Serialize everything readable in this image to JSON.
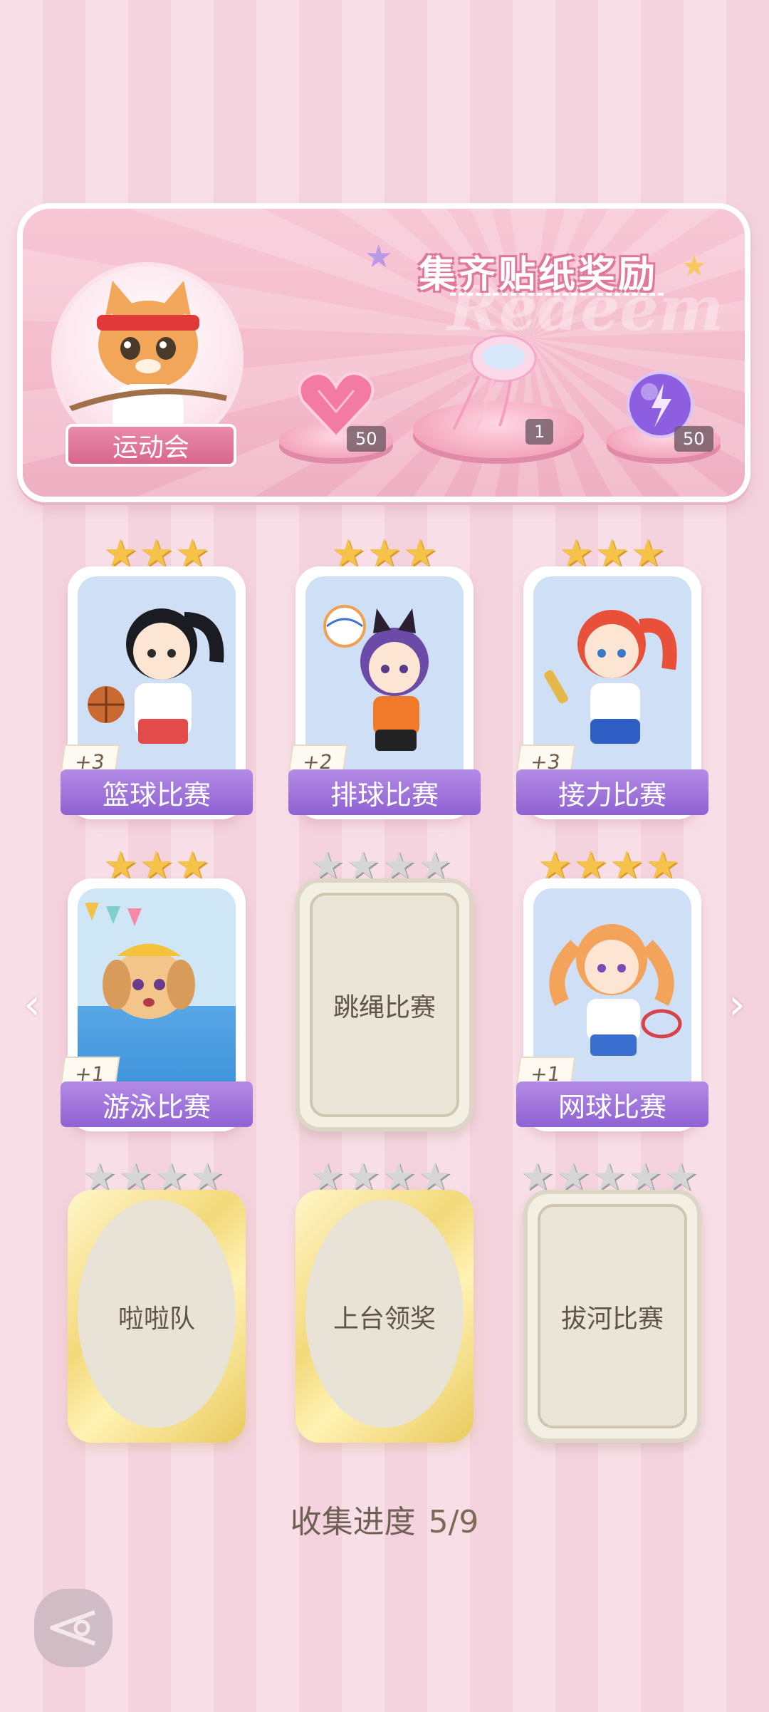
{
  "banner": {
    "title": "集齐贴纸奖励",
    "ghost_text": "Redeem",
    "event_tag": "运动会",
    "rewards": [
      {
        "icon": "pink-heart-gem-icon",
        "count": "50"
      },
      {
        "icon": "jellyfish-trophy-icon",
        "count": "1"
      },
      {
        "icon": "purple-energy-orb-icon",
        "count": "50"
      }
    ]
  },
  "cards": [
    {
      "label": "篮球比赛",
      "bonus": "+3",
      "stars": 3,
      "state": "collected"
    },
    {
      "label": "排球比赛",
      "bonus": "+2",
      "stars": 3,
      "state": "collected"
    },
    {
      "label": "接力比赛",
      "bonus": "+3",
      "stars": 3,
      "state": "collected"
    },
    {
      "label": "游泳比赛",
      "bonus": "+1",
      "stars": 3,
      "state": "collected"
    },
    {
      "label": "跳绳比赛",
      "stars": 4,
      "state": "locked"
    },
    {
      "label": "网球比赛",
      "bonus": "+1",
      "stars": 4,
      "state": "collected"
    },
    {
      "label": "啦啦队",
      "stars": 4,
      "state": "locked-gold"
    },
    {
      "label": "上台领奖",
      "stars": 4,
      "state": "locked-gold"
    },
    {
      "label": "拔河比赛",
      "stars": 5,
      "state": "locked"
    }
  ],
  "progress": {
    "label": "收集进度",
    "value": "5/9"
  },
  "nav": {
    "prev_icon": "chevron-left-icon",
    "next_icon": "chevron-right-icon",
    "back_icon": "back-arrow-icon"
  },
  "colors": {
    "accent_purple": "#9b6fd9",
    "gold_star": "#f5c24a",
    "banner_pink": "#f4bccd"
  }
}
